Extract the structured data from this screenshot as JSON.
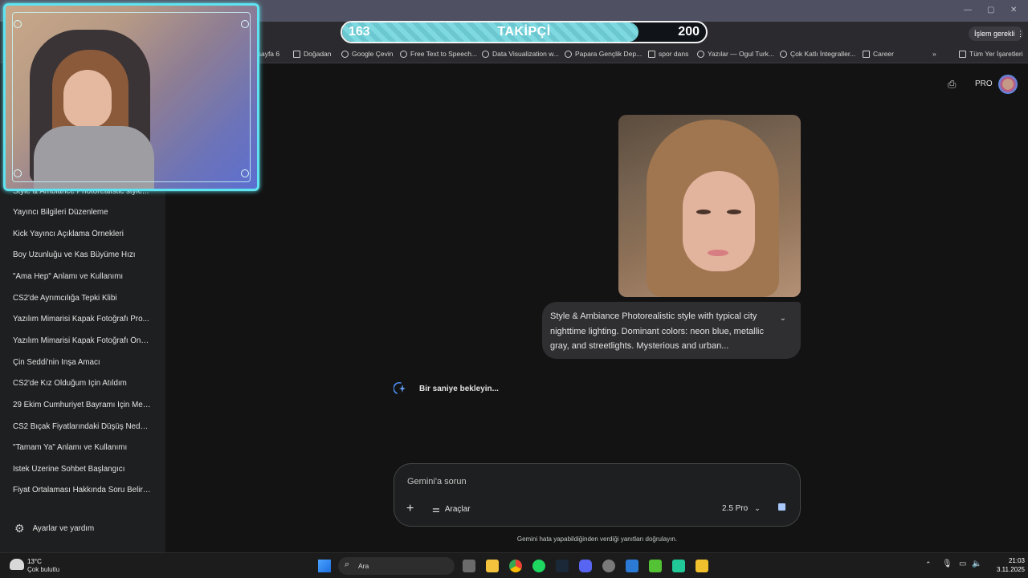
{
  "browser": {
    "top_right_action": "İşlem gerekli",
    "bookmarks": [
      "t sayfa 6",
      "Doğadan",
      "Google Çevin",
      "Free Text to Speech...",
      "Data Visualization w...",
      "Papara Gençlik Dep...",
      "spor dans",
      "Yazılar — Ogul Turk...",
      "Çok Katlı İntegraller...",
      "Career"
    ],
    "all_bookmarks": "Tüm Yer İşaretleri",
    "overflow": "»"
  },
  "overlay": {
    "follower_current": "163",
    "follower_goal": "200",
    "follower_label": "TAKİPÇİ",
    "follower_progress": 0.815
  },
  "header": {
    "pro_badge": "PRO"
  },
  "sidebar": {
    "partial_item": "Style & Ambiance Photorealistic style...",
    "items": [
      "Yayıncı Bilgileri Düzenleme",
      "Kick Yayıncı Açıklama Örnekleri",
      "Boy Uzunluğu ve Kas Büyüme Hızı",
      "\"Ama Hep\" Anlamı ve Kullanımı",
      "CS2'de Ayrımcılığa Tepki Klibi",
      "Yazılım Mimarisi Kapak Fotoğrafı Pro...",
      "Yazılım Mimarisi Kapak Fotoğrafı Öne...",
      "Çin Seddi'nin İnşa Amacı",
      "CS2'de Kız Olduğum İçin Atıldım",
      "29 Ekim Cumhuriyet Bayramı İçin Met...",
      "CS2 Bıçak Fiyatlarındaki Düşüş Nede...",
      "\"Tamam Ya\" Anlamı ve Kullanımı",
      "İstek Üzerine Sohbet Başlangıcı",
      "Fiyat Ortalaması Hakkında Soru Belirs..."
    ],
    "settings_label": "Ayarlar ve yardım"
  },
  "chat": {
    "user_prompt": "Style & Ambiance Photorealistic style with typical city nighttime lighting. Dominant colors: neon blue, metallic gray, and streetlights. Mysterious and urban...",
    "thinking_text": "Bir saniye bekleyin..."
  },
  "composer": {
    "placeholder": "Gemini'a sorun",
    "tools_label": "Araçlar",
    "model_label": "2.5 Pro",
    "disclaimer": "Gemini hata yapabildiğinden verdiği yanıtları doğrulayın."
  },
  "taskbar": {
    "weather_temp": "13°C",
    "weather_desc": "Çok bulutlu",
    "search_placeholder": "Ara",
    "time": "21:03",
    "date": "3.11.2025"
  },
  "colors": {
    "accent_cyan": "#5fe3f0",
    "gemini_blue": "#4c8df6",
    "bg": "#131314"
  }
}
